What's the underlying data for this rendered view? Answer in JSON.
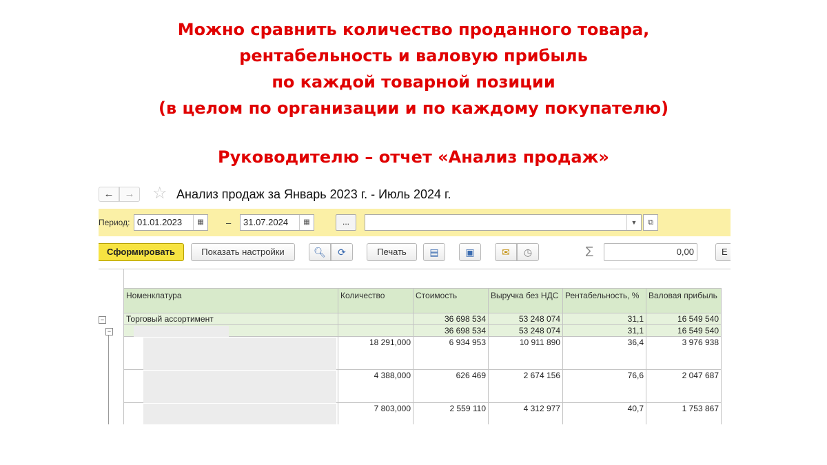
{
  "headline": {
    "line1": "Можно сравнить количество проданного товара,",
    "line2": "рентабельность и валовую прибыль",
    "line3": "по каждой товарной позиции",
    "line4": "(в целом по организации и по каждому покупателю)",
    "line5": "Руководителю –  отчет «Анализ продаж»"
  },
  "window": {
    "back_icon": "←",
    "forward_icon": "→",
    "star_icon": "☆",
    "title": "Анализ продаж за Январь 2023 г. - Июль 2024 г."
  },
  "period": {
    "label": "Период:",
    "from": "01.01.2023",
    "to": "31.07.2024",
    "dash": "–",
    "dots": "...",
    "organization": ""
  },
  "toolbar": {
    "run_label": "Сформировать",
    "settings_label": "Показать настройки",
    "print_label": "Печать",
    "sum_value": "0,00",
    "more_label": "Е"
  },
  "colors": {
    "headline": "#e00000",
    "period_bar": "#fbf0a6",
    "run_button": "#f7e341",
    "table_header": "#d8eacb",
    "group_row": "#e6f2dc"
  },
  "table": {
    "columns": [
      "Номенклатура",
      "Количество",
      "Стоимость",
      "Выручка без НДС",
      "Рентабельность, %",
      "Валовая прибыль"
    ],
    "rows": [
      {
        "name": "Торговый ассортимент",
        "qty": "",
        "cost": "36 698 534",
        "revenue": "53 248 074",
        "margin": "31,1",
        "profit": "16 549 540"
      },
      {
        "name": "",
        "qty": "",
        "cost": "36 698 534",
        "revenue": "53 248 074",
        "margin": "31,1",
        "profit": "16 549 540"
      },
      {
        "name": "",
        "qty": "18 291,000",
        "cost": "6 934 953",
        "revenue": "10 911 890",
        "margin": "36,4",
        "profit": "3 976 938"
      },
      {
        "name": "",
        "qty": "4 388,000",
        "cost": "626 469",
        "revenue": "2 674 156",
        "margin": "76,6",
        "profit": "2 047 687"
      },
      {
        "name": "",
        "qty": "7 803,000",
        "cost": "2 559 110",
        "revenue": "4 312 977",
        "margin": "40,7",
        "profit": "1 753 867"
      }
    ]
  }
}
